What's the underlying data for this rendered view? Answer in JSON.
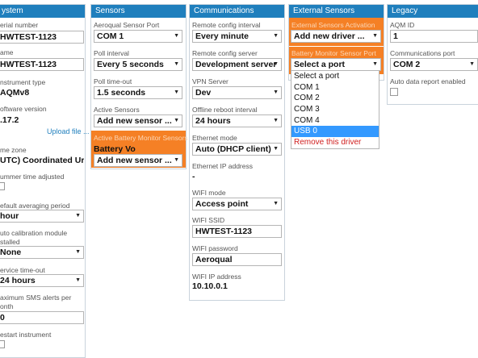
{
  "system": {
    "title": "ystem",
    "serial_label": "erial number",
    "serial_value": "HWTEST-1123",
    "name_label": "ame",
    "name_value": "HWTEST-1123",
    "instrument_type_label": "nstrument type",
    "instrument_type_value": "AQMv8",
    "software_version_label": "oftware version",
    "software_version_value": ".17.2",
    "upload_link": "Upload file ...",
    "timezone_label": "me zone",
    "timezone_value": "UTC) Coordinated Ur",
    "summer_time_label": "ummer time adjusted",
    "avg_period_label": "efault averaging period",
    "avg_period_value": " hour",
    "auto_cal_label_1": "uto calibration module",
    "auto_cal_label_2": "stalled",
    "auto_cal_value": "None",
    "service_timeout_label": "ervice time-out",
    "service_timeout_value": "24 hours",
    "max_sms_label_1": "aximum SMS alerts per",
    "max_sms_label_2": "onth",
    "max_sms_value": "0",
    "restart_label": "estart instrument"
  },
  "sensors": {
    "title": "Sensors",
    "aero_port_label": "Aeroqual Sensor Port",
    "aero_port_value": "COM 1",
    "poll_interval_label": "Poll interval",
    "poll_interval_value": "Every 5 seconds",
    "poll_timeout_label": "Poll time-out",
    "poll_timeout_value": "1.5 seconds",
    "active_sensors_label": "Active Sensors",
    "active_sensors_value": "Add new sensor ...",
    "battery_monitor_label": "Active Battery Monitor Sensors",
    "battery_text": "Battery Vo",
    "battery_add_value": "Add new sensor ..."
  },
  "communications": {
    "title": "Communications",
    "remote_interval_label": "Remote config interval",
    "remote_interval_value": "Every minute",
    "remote_server_label": "Remote config server",
    "remote_server_value": "Development server",
    "vpn_label": "VPN Server",
    "vpn_value": "Dev",
    "offline_reboot_label": "Offline reboot interval",
    "offline_reboot_value": "24 hours",
    "eth_mode_label": "Ethernet mode",
    "eth_mode_value": "Auto (DHCP client)",
    "eth_ip_label": "Ethernet IP address",
    "eth_ip_value": "-",
    "wifi_mode_label": "WIFI mode",
    "wifi_mode_value": "Access point",
    "wifi_ssid_label": "WIFI SSID",
    "wifi_ssid_value": "HWTEST-1123",
    "wifi_password_label": "WIFI password",
    "wifi_password_value": "Aeroqual",
    "wifi_ip_label": "WIFI IP address",
    "wifi_ip_value": "10.10.0.1"
  },
  "external": {
    "title": "External Sensors",
    "activation_label": "External Sensors Activation",
    "activation_value": "Add new driver ...",
    "battery_port_label": "Battery Monitor Sensor Port",
    "battery_port_value": "Select a port",
    "options": [
      "Select a port",
      "COM 1",
      "COM 2",
      "COM 3",
      "COM 4",
      "USB 0",
      "Remove this driver"
    ]
  },
  "legacy": {
    "title": "Legacy",
    "aqm_id_label": "AQM ID",
    "aqm_id_value": "1",
    "comm_port_label": "Communications port",
    "comm_port_value": "COM 2",
    "auto_report_label": "Auto data report enabled"
  },
  "colors": {
    "header": "#1f7fbd",
    "highlight": "#f58025",
    "selected_option": "#3399ff",
    "remove_option": "#d02020"
  }
}
